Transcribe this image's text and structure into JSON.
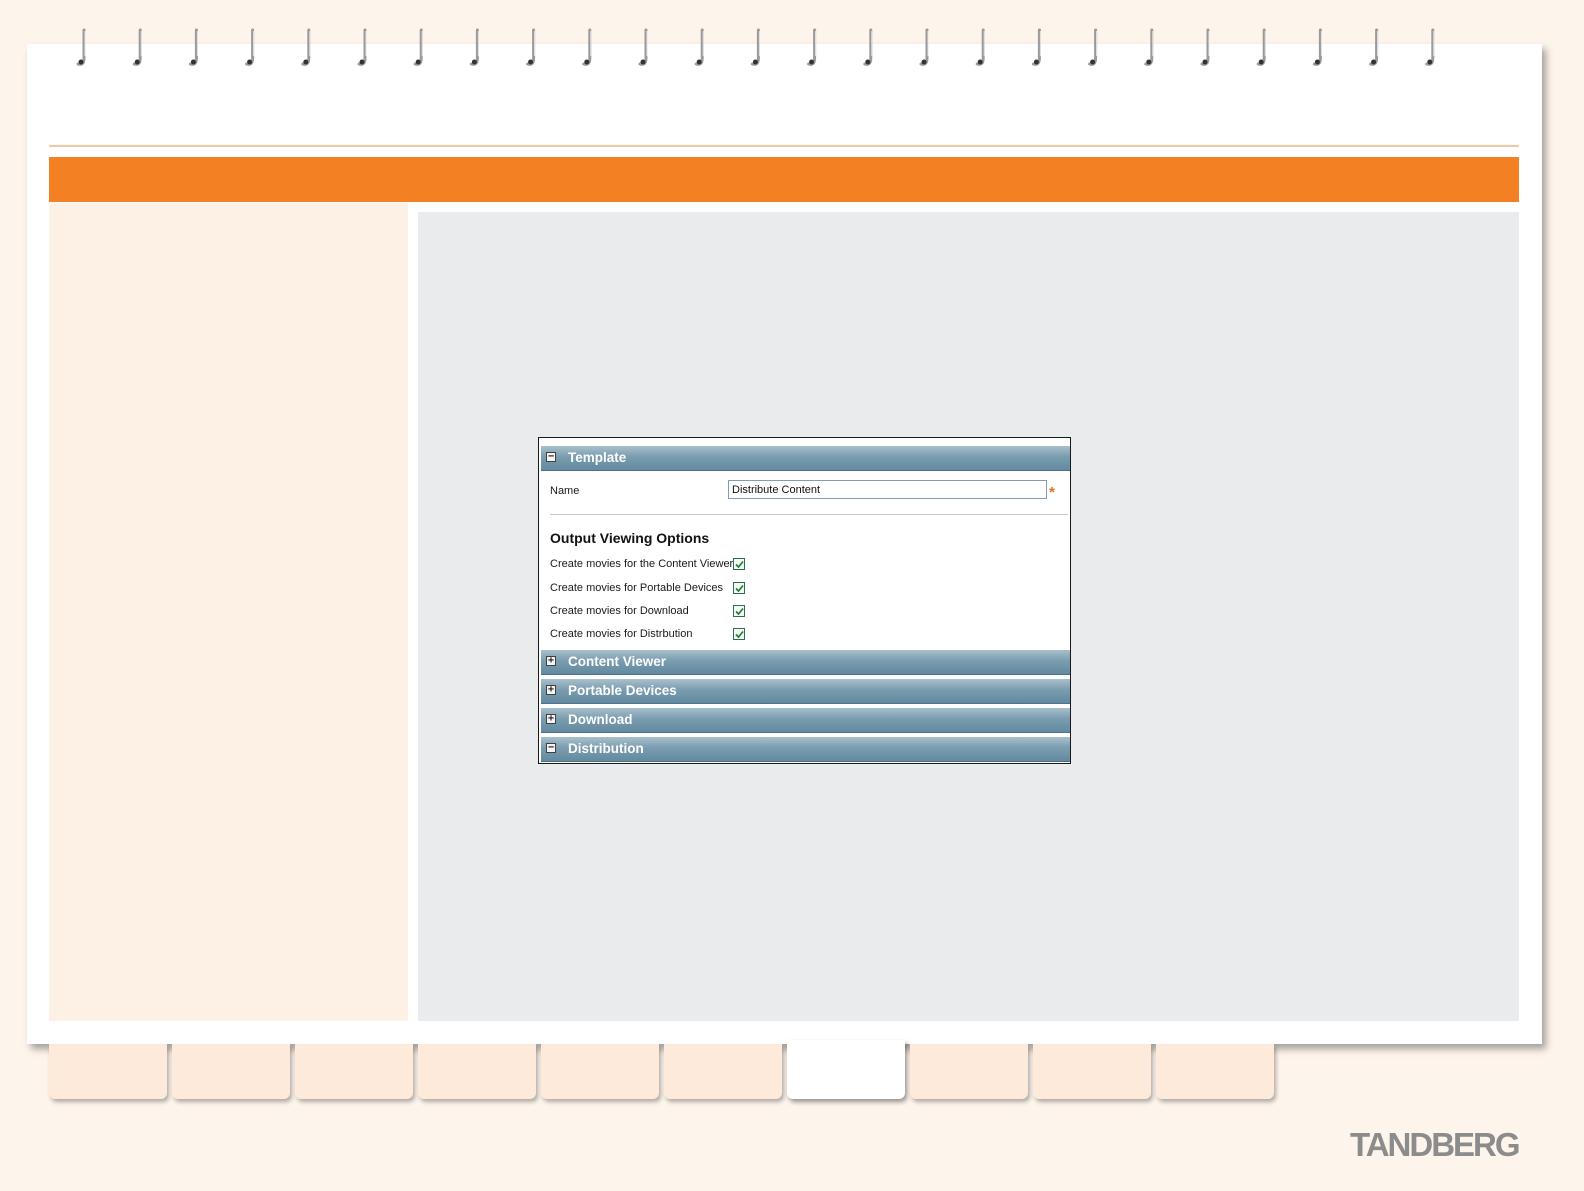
{
  "brand": {
    "name": "TANDBERG"
  },
  "tabs": {
    "count": 10,
    "active_index": 6
  },
  "form": {
    "template_section": {
      "label": "Template",
      "toggle": "−",
      "expanded": true
    },
    "name_field": {
      "label": "Name",
      "value": "Distribute Content",
      "required_marker": "*"
    },
    "output_viewing_options": {
      "title": "Output Viewing Options",
      "options": [
        {
          "label": "Create movies for the Content Viewer",
          "checked": true
        },
        {
          "label": "Create movies for Portable Devices",
          "checked": true
        },
        {
          "label": "Create movies for Download",
          "checked": true
        },
        {
          "label": "Create movies for Distrbution",
          "checked": true
        }
      ]
    },
    "sections": [
      {
        "label": "Content Viewer",
        "toggle": "+",
        "expanded": false
      },
      {
        "label": "Portable Devices",
        "toggle": "+",
        "expanded": false
      },
      {
        "label": "Download",
        "toggle": "+",
        "expanded": false
      },
      {
        "label": "Distribution",
        "toggle": "−",
        "expanded": true
      }
    ]
  },
  "colors": {
    "accent_orange": "#f48024",
    "section_header": "#6f94a8",
    "page_background": "#fdf4ec"
  }
}
